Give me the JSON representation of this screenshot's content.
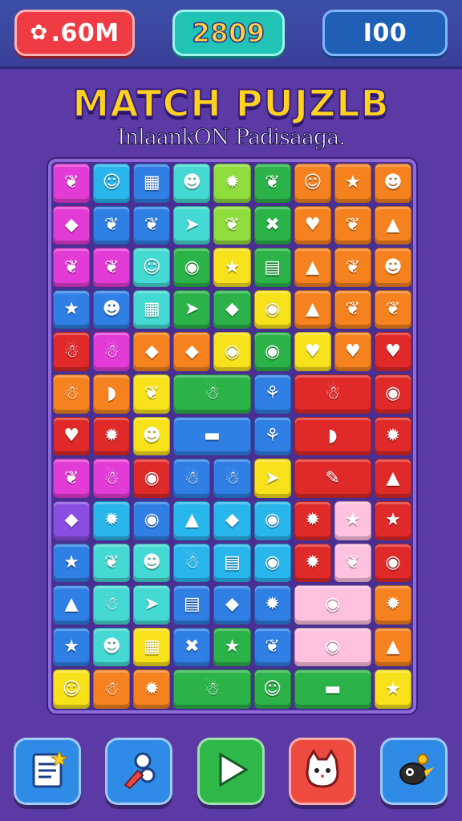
{
  "hud": {
    "coins_icon": "bag-icon",
    "coins_value": ".60M",
    "score_value": "2809",
    "moves_value": "I00"
  },
  "title": "MATCH PUJZLB",
  "subtitle": "InlaankON Padisaaga.",
  "colors": {
    "m": "#e33bd6",
    "c": "#29b6ec",
    "b": "#2f7fe4",
    "g": "#2bb34a",
    "y": "#f6e11a",
    "o": "#f5821f",
    "r": "#e02a2a",
    "t": "#45d9d3",
    "l": "#8fdc3d",
    "p": "#ffc1e0",
    "v": "#8a4fe0"
  },
  "board": {
    "cols": 8,
    "rows": 13,
    "tiles": [
      {
        "r": 0,
        "c": 0,
        "color": "m",
        "icon": "leaf-icon"
      },
      {
        "r": 0,
        "c": 1,
        "color": "c",
        "icon": "ghost-icon"
      },
      {
        "r": 0,
        "c": 2,
        "color": "b",
        "icon": "calculator-icon"
      },
      {
        "r": 0,
        "c": 3,
        "color": "t",
        "icon": "frog-icon"
      },
      {
        "r": 0,
        "c": 4,
        "color": "l",
        "icon": "splat-icon"
      },
      {
        "r": 0,
        "c": 5,
        "color": "g",
        "icon": "leaf-icon"
      },
      {
        "r": 0,
        "c": 6,
        "color": "o",
        "icon": "smile-icon"
      },
      {
        "r": 0,
        "c": 7,
        "color": "o",
        "icon": "star-icon"
      },
      {
        "r": 0,
        "c": 8,
        "color": "o",
        "icon": "frog-icon"
      },
      {
        "r": 1,
        "c": 0,
        "color": "m",
        "icon": "fish-icon"
      },
      {
        "r": 1,
        "c": 1,
        "color": "b",
        "icon": "leaf-icon"
      },
      {
        "r": 1,
        "c": 2,
        "color": "b",
        "icon": "leaf-icon"
      },
      {
        "r": 1,
        "c": 3,
        "color": "t",
        "icon": "bird-icon"
      },
      {
        "r": 1,
        "c": 4,
        "color": "l",
        "icon": "leaf-icon"
      },
      {
        "r": 1,
        "c": 5,
        "color": "g",
        "icon": "cross-icon"
      },
      {
        "r": 1,
        "c": 6,
        "color": "o",
        "icon": "heart-icon"
      },
      {
        "r": 1,
        "c": 7,
        "color": "o",
        "icon": "leaf-icon"
      },
      {
        "r": 1,
        "c": 8,
        "color": "o",
        "icon": "drop-icon"
      },
      {
        "r": 2,
        "c": 0,
        "color": "m",
        "icon": "leaf-icon"
      },
      {
        "r": 2,
        "c": 1,
        "color": "m",
        "icon": "leaf-icon"
      },
      {
        "r": 2,
        "c": 2,
        "color": "t",
        "icon": "ghost-icon"
      },
      {
        "r": 2,
        "c": 3,
        "color": "g",
        "icon": "face-icon"
      },
      {
        "r": 2,
        "c": 4,
        "color": "y",
        "icon": "star-icon"
      },
      {
        "r": 2,
        "c": 5,
        "color": "g",
        "icon": "jar-icon"
      },
      {
        "r": 2,
        "c": 6,
        "color": "o",
        "icon": "drop-icon"
      },
      {
        "r": 2,
        "c": 7,
        "color": "o",
        "icon": "leaf-icon"
      },
      {
        "r": 2,
        "c": 8,
        "color": "o",
        "icon": "frog-icon"
      },
      {
        "r": 3,
        "c": 0,
        "color": "b",
        "icon": "star-icon"
      },
      {
        "r": 3,
        "c": 1,
        "color": "b",
        "icon": "frog-icon"
      },
      {
        "r": 3,
        "c": 2,
        "color": "t",
        "icon": "calculator-icon"
      },
      {
        "r": 3,
        "c": 3,
        "color": "g",
        "icon": "bird-icon"
      },
      {
        "r": 3,
        "c": 4,
        "color": "g",
        "icon": "fish-icon"
      },
      {
        "r": 3,
        "c": 5,
        "color": "y",
        "icon": "face-icon"
      },
      {
        "r": 3,
        "c": 6,
        "color": "o",
        "icon": "drop-icon"
      },
      {
        "r": 3,
        "c": 7,
        "color": "o",
        "icon": "leaf-icon"
      },
      {
        "r": 3,
        "c": 8,
        "color": "o",
        "icon": "leaf-icon"
      },
      {
        "r": 4,
        "c": 0,
        "color": "r",
        "icon": "cat-icon"
      },
      {
        "r": 4,
        "c": 1,
        "color": "m",
        "icon": "cat-icon"
      },
      {
        "r": 4,
        "c": 2,
        "color": "o",
        "icon": "fish-icon"
      },
      {
        "r": 4,
        "c": 3,
        "color": "o",
        "icon": "fish-icon"
      },
      {
        "r": 4,
        "c": 4,
        "color": "y",
        "icon": "face-icon"
      },
      {
        "r": 4,
        "c": 5,
        "color": "g",
        "icon": "face-icon"
      },
      {
        "r": 4,
        "c": 6,
        "color": "y",
        "icon": "heart-icon"
      },
      {
        "r": 4,
        "c": 7,
        "color": "o",
        "icon": "heart-icon"
      },
      {
        "r": 4,
        "c": 8,
        "color": "r",
        "icon": "heart-icon"
      },
      {
        "r": 5,
        "c": 0,
        "color": "o",
        "icon": "cat-icon"
      },
      {
        "r": 5,
        "c": 1,
        "color": "o",
        "icon": "banana-icon"
      },
      {
        "r": 5,
        "c": 2,
        "color": "y",
        "icon": "leaf-icon"
      },
      {
        "r": 5,
        "c": 3,
        "color": "g",
        "w": 2,
        "icon": "cat-icon"
      },
      {
        "r": 5,
        "c": 5,
        "color": "b",
        "icon": "ribbon-icon"
      },
      {
        "r": 5,
        "c": 6,
        "color": "r",
        "w": 2,
        "icon": "cat-icon"
      },
      {
        "r": 5,
        "c": 8,
        "color": "r",
        "icon": "face-icon"
      },
      {
        "r": 6,
        "c": 0,
        "color": "r",
        "icon": "heart-icon"
      },
      {
        "r": 6,
        "c": 1,
        "color": "r",
        "icon": "splat-icon"
      },
      {
        "r": 6,
        "c": 2,
        "color": "y",
        "icon": "frog-icon"
      },
      {
        "r": 6,
        "c": 3,
        "color": "b",
        "w": 2,
        "icon": "boat-icon"
      },
      {
        "r": 6,
        "c": 5,
        "color": "b",
        "icon": "ribbon-icon"
      },
      {
        "r": 6,
        "c": 6,
        "color": "r",
        "w": 2,
        "icon": "banana-icon"
      },
      {
        "r": 6,
        "c": 8,
        "color": "r",
        "icon": "splat-icon"
      },
      {
        "r": 7,
        "c": 0,
        "color": "m",
        "icon": "leaf-icon"
      },
      {
        "r": 7,
        "c": 1,
        "color": "m",
        "icon": "cat-icon"
      },
      {
        "r": 7,
        "c": 2,
        "color": "r",
        "icon": "face-icon"
      },
      {
        "r": 7,
        "c": 3,
        "color": "b",
        "icon": "cat-icon"
      },
      {
        "r": 7,
        "c": 4,
        "color": "b",
        "icon": "cat-icon"
      },
      {
        "r": 7,
        "c": 5,
        "color": "y",
        "icon": "bird-icon"
      },
      {
        "r": 7,
        "c": 6,
        "color": "r",
        "w": 2,
        "icon": "pencil-icon"
      },
      {
        "r": 7,
        "c": 8,
        "color": "r",
        "icon": "drop-icon"
      },
      {
        "r": 8,
        "c": 0,
        "color": "v",
        "icon": "fish-icon"
      },
      {
        "r": 8,
        "c": 1,
        "color": "c",
        "icon": "splat-icon"
      },
      {
        "r": 8,
        "c": 2,
        "color": "b",
        "icon": "face-icon"
      },
      {
        "r": 8,
        "c": 3,
        "color": "c",
        "icon": "drop-icon"
      },
      {
        "r": 8,
        "c": 4,
        "color": "c",
        "icon": "fish-icon"
      },
      {
        "r": 8,
        "c": 5,
        "color": "c",
        "icon": "face-icon"
      },
      {
        "r": 8,
        "c": 6,
        "color": "r",
        "icon": "splat-icon"
      },
      {
        "r": 8,
        "c": 7,
        "color": "p",
        "icon": "star-icon"
      },
      {
        "r": 8,
        "c": 8,
        "color": "r",
        "icon": "star-icon"
      },
      {
        "r": 9,
        "c": 0,
        "color": "b",
        "icon": "star-icon"
      },
      {
        "r": 9,
        "c": 1,
        "color": "t",
        "icon": "leaf-icon"
      },
      {
        "r": 9,
        "c": 2,
        "color": "t",
        "icon": "frog-icon"
      },
      {
        "r": 9,
        "c": 3,
        "color": "c",
        "icon": "cat-icon"
      },
      {
        "r": 9,
        "c": 4,
        "color": "c",
        "icon": "jar-icon"
      },
      {
        "r": 9,
        "c": 5,
        "color": "c",
        "icon": "face-icon"
      },
      {
        "r": 9,
        "c": 6,
        "color": "r",
        "icon": "splat-icon"
      },
      {
        "r": 9,
        "c": 7,
        "color": "p",
        "icon": "leaf-icon"
      },
      {
        "r": 9,
        "c": 8,
        "color": "r",
        "icon": "face-icon"
      },
      {
        "r": 10,
        "c": 0,
        "color": "b",
        "icon": "drop-icon"
      },
      {
        "r": 10,
        "c": 1,
        "color": "t",
        "icon": "cat-icon"
      },
      {
        "r": 10,
        "c": 2,
        "color": "t",
        "icon": "bird-icon"
      },
      {
        "r": 10,
        "c": 3,
        "color": "b",
        "icon": "jar-icon"
      },
      {
        "r": 10,
        "c": 4,
        "color": "b",
        "icon": "fish-icon"
      },
      {
        "r": 10,
        "c": 5,
        "color": "b",
        "icon": "splat-icon"
      },
      {
        "r": 10,
        "c": 6,
        "color": "p",
        "w": 2,
        "icon": "face-icon"
      },
      {
        "r": 10,
        "c": 8,
        "color": "o",
        "icon": "splat-icon"
      },
      {
        "r": 11,
        "c": 0,
        "color": "b",
        "icon": "star-icon"
      },
      {
        "r": 11,
        "c": 1,
        "color": "t",
        "icon": "frog-icon"
      },
      {
        "r": 11,
        "c": 2,
        "color": "y",
        "icon": "calculator-icon"
      },
      {
        "r": 11,
        "c": 3,
        "color": "b",
        "icon": "cross-icon"
      },
      {
        "r": 11,
        "c": 4,
        "color": "g",
        "icon": "star-icon"
      },
      {
        "r": 11,
        "c": 5,
        "color": "b",
        "icon": "leaf-icon"
      },
      {
        "r": 11,
        "c": 6,
        "color": "p",
        "w": 2,
        "icon": "face-icon"
      },
      {
        "r": 11,
        "c": 8,
        "color": "o",
        "icon": "drop-icon"
      },
      {
        "r": 12,
        "c": 0,
        "color": "y",
        "icon": "ghost-icon"
      },
      {
        "r": 12,
        "c": 1,
        "color": "o",
        "icon": "cat-icon"
      },
      {
        "r": 12,
        "c": 2,
        "color": "o",
        "icon": "splat-icon"
      },
      {
        "r": 12,
        "c": 3,
        "color": "g",
        "w": 2,
        "icon": "cat-icon"
      },
      {
        "r": 12,
        "c": 5,
        "color": "g",
        "icon": "smile-icon"
      },
      {
        "r": 12,
        "c": 6,
        "color": "g",
        "w": 2,
        "icon": "boat-icon"
      },
      {
        "r": 12,
        "c": 8,
        "color": "y",
        "icon": "star-icon"
      }
    ]
  },
  "bottom_buttons": [
    {
      "name": "notes-button",
      "icon": "notes-icon",
      "color": "#2f8ce6"
    },
    {
      "name": "tools-button",
      "icon": "tools-icon",
      "color": "#2f8ce6"
    },
    {
      "name": "play-button",
      "icon": "play-icon",
      "color": "#2fb84a"
    },
    {
      "name": "cat-button",
      "icon": "cat-icon",
      "color": "#ef4a3f"
    },
    {
      "name": "bird-button",
      "icon": "bird-icon",
      "color": "#2f8ce6"
    }
  ]
}
